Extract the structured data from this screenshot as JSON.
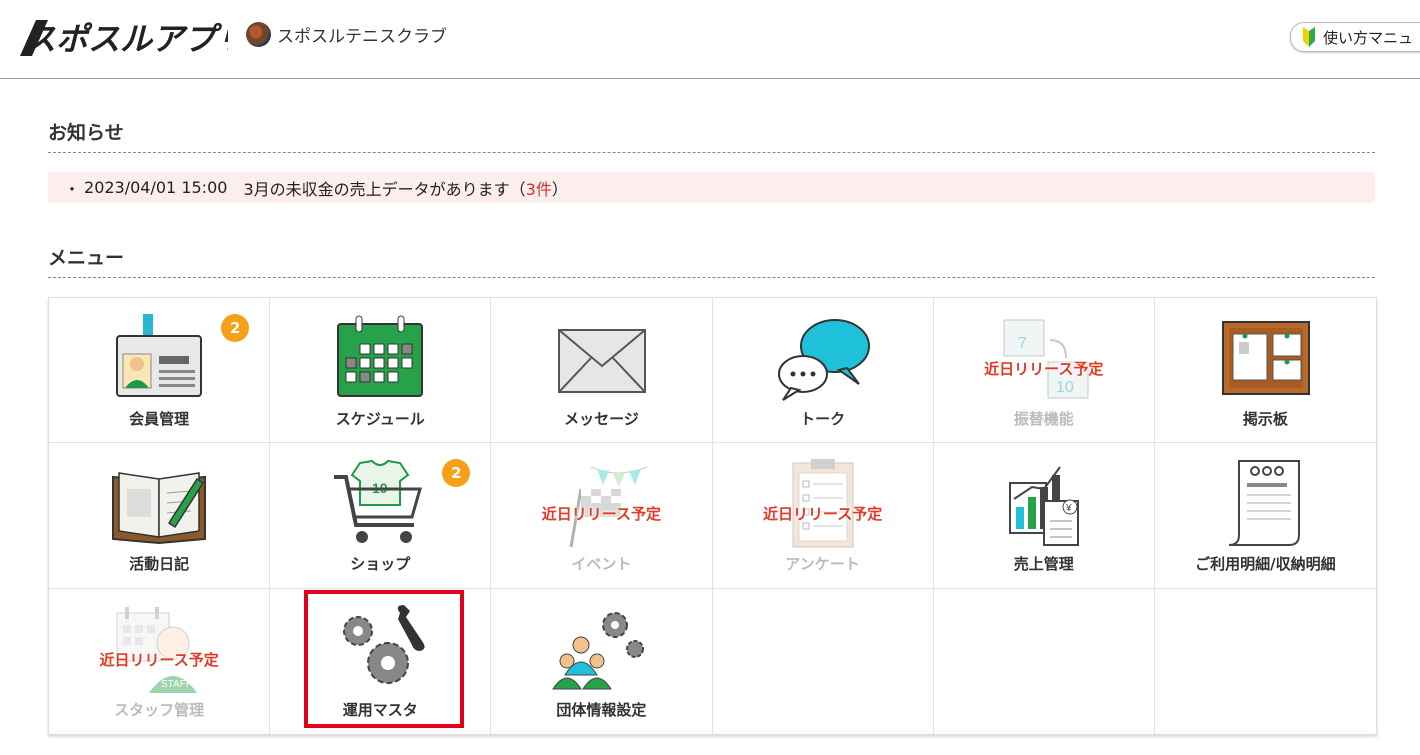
{
  "header": {
    "logo_text": "スポスルアプリ",
    "club_name": "スポスルテニスクラブ",
    "manual_label": "使い方マニュ"
  },
  "notice": {
    "title": "お知らせ",
    "bullet": "・",
    "datetime": "2023/04/01 15:00",
    "message": "3月の未収金の売上データがあります",
    "paren_open": "（",
    "count_label": "3件",
    "paren_close": "）"
  },
  "menu": {
    "title": "メニュー",
    "soon_label": "近日リリース予定",
    "items": [
      {
        "label": "会員管理",
        "badge": "2",
        "icon": "member-card-icon"
      },
      {
        "label": "スケジュール",
        "icon": "calendar-icon"
      },
      {
        "label": "メッセージ",
        "icon": "envelope-icon"
      },
      {
        "label": "トーク",
        "icon": "chat-bubbles-icon"
      },
      {
        "label": "振替機能",
        "icon": "calendar-transfer-icon",
        "disabled": true
      },
      {
        "label": "掲示板",
        "icon": "bulletin-board-icon"
      },
      {
        "label": "活動日記",
        "icon": "diary-book-icon"
      },
      {
        "label": "ショップ",
        "badge": "2",
        "icon": "shopping-cart-icon"
      },
      {
        "label": "イベント",
        "icon": "event-flag-icon",
        "disabled": true
      },
      {
        "label": "アンケート",
        "icon": "clipboard-survey-icon",
        "disabled": true
      },
      {
        "label": "売上管理",
        "icon": "sales-chart-icon"
      },
      {
        "label": "ご利用明細/収納明細",
        "icon": "receipt-icon"
      },
      {
        "label": "スタッフ管理",
        "icon": "staff-icon",
        "disabled": true
      },
      {
        "label": "運用マスタ",
        "icon": "gears-wrench-icon"
      },
      {
        "label": "団体情報設定",
        "icon": "group-settings-icon"
      }
    ]
  },
  "colors": {
    "badge": "#f4a019",
    "soon": "#e23a24",
    "notice_bg": "#fdeeee",
    "highlight": "#e2001a",
    "brand_green": "#25a244"
  }
}
